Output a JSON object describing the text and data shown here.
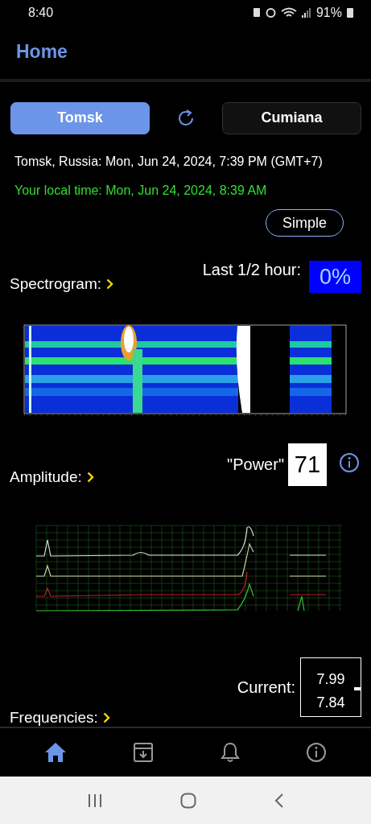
{
  "status_bar": {
    "time": "8:40",
    "battery": "91%"
  },
  "header": {
    "title": "Home"
  },
  "locations": [
    {
      "label": "Tomsk",
      "selected": true
    },
    {
      "label": "Cumiana",
      "selected": false
    }
  ],
  "location_time": "Tomsk, Russia: Mon, Jun 24, 2024, 7:39 PM (GMT+7)",
  "local_time": "Your local time: Mon, Jun 24, 2024, 8:39 AM",
  "mode_button": "Simple",
  "spectrogram": {
    "label": "Spectrogram:",
    "last_label": "Last 1/2 hour:",
    "last_value": "0%",
    "kind": "picture"
  },
  "amplitude": {
    "label": "Amplitude:",
    "power_label": "\"Power\"",
    "power_value": "71",
    "kind": "picture"
  },
  "current": {
    "label": "Current:",
    "values": [
      "7.99",
      "7.84"
    ]
  },
  "frequencies": {
    "label": "Frequencies:"
  },
  "bottom_nav": [
    {
      "kind": "home",
      "selected": true
    },
    {
      "kind": "archive",
      "selected": false
    },
    {
      "kind": "bell",
      "selected": false
    },
    {
      "kind": "info",
      "selected": false
    }
  ]
}
